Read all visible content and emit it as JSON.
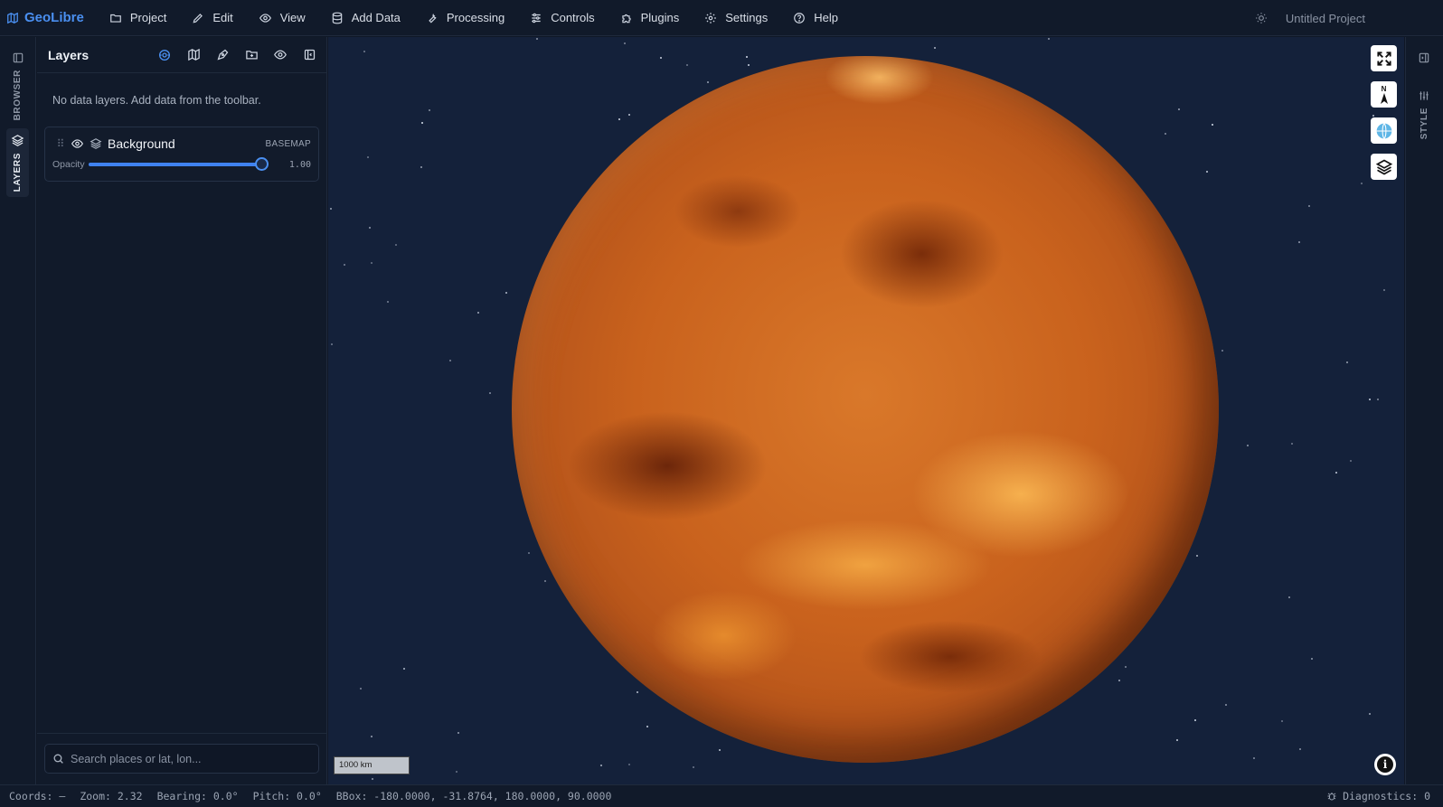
{
  "app": {
    "name": "GeoLibre",
    "project_title": "Untitled Project"
  },
  "menu": [
    {
      "label": "Project",
      "icon": "folder-icon"
    },
    {
      "label": "Edit",
      "icon": "pencil-icon"
    },
    {
      "label": "View",
      "icon": "eye-icon"
    },
    {
      "label": "Add Data",
      "icon": "database-icon"
    },
    {
      "label": "Processing",
      "icon": "wrench-icon"
    },
    {
      "label": "Controls",
      "icon": "sliders-icon"
    },
    {
      "label": "Plugins",
      "icon": "puzzle-icon"
    },
    {
      "label": "Settings",
      "icon": "gear-icon"
    },
    {
      "label": "Help",
      "icon": "help-circle-icon"
    }
  ],
  "left_rail": {
    "browser_label": "BROWSER",
    "layers_label": "LAYERS"
  },
  "layers_panel": {
    "title": "Layers",
    "empty_message": "No data layers. Add data from the toolbar.",
    "layer": {
      "name": "Background",
      "badge": "BASEMAP",
      "opacity_label": "Opacity",
      "opacity_value": "1.00",
      "opacity_fraction": 1.0
    },
    "search_placeholder": "Search places or lat, lon..."
  },
  "map": {
    "scale_label": "1000 km",
    "compass_letter": "N",
    "colors": {
      "planet": "#c9621d",
      "background": "#14213a",
      "accent": "#4a8ff0"
    }
  },
  "right_rail": {
    "style_label": "STYLE"
  },
  "status": {
    "coords": "Coords: —",
    "zoom": "Zoom: 2.32",
    "bearing": "Bearing: 0.0°",
    "pitch": "Pitch: 0.0°",
    "bbox": "BBox: -180.0000, -31.8764, 180.0000, 90.0000",
    "diagnostics": "Diagnostics: 0"
  }
}
